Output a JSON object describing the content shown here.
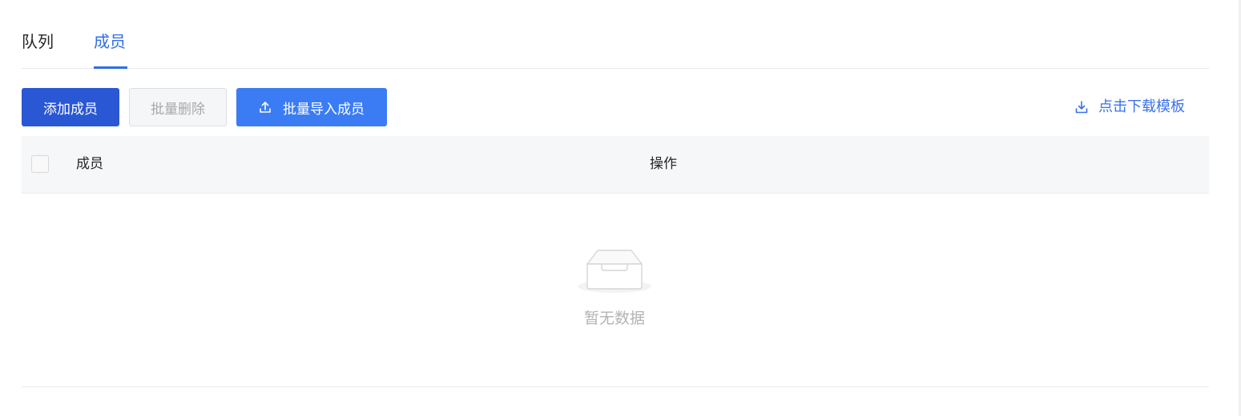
{
  "tabs": [
    {
      "label": "队列",
      "active": false
    },
    {
      "label": "成员",
      "active": true
    }
  ],
  "toolbar": {
    "add_label": "添加成员",
    "batch_delete_label": "批量删除",
    "batch_import_label": "批量导入成员",
    "download_template_label": "点击下载模板"
  },
  "table": {
    "columns": [
      "成员",
      "操作"
    ],
    "rows": [],
    "empty_text": "暂无数据"
  },
  "icons": {
    "import": "upload-icon",
    "download": "download-icon",
    "empty": "empty-inbox-icon"
  },
  "colors": {
    "primary": "#2a57d3",
    "accent": "#3b7cf5",
    "link": "#3a72e6",
    "active_tab": "#2f6fe4"
  }
}
